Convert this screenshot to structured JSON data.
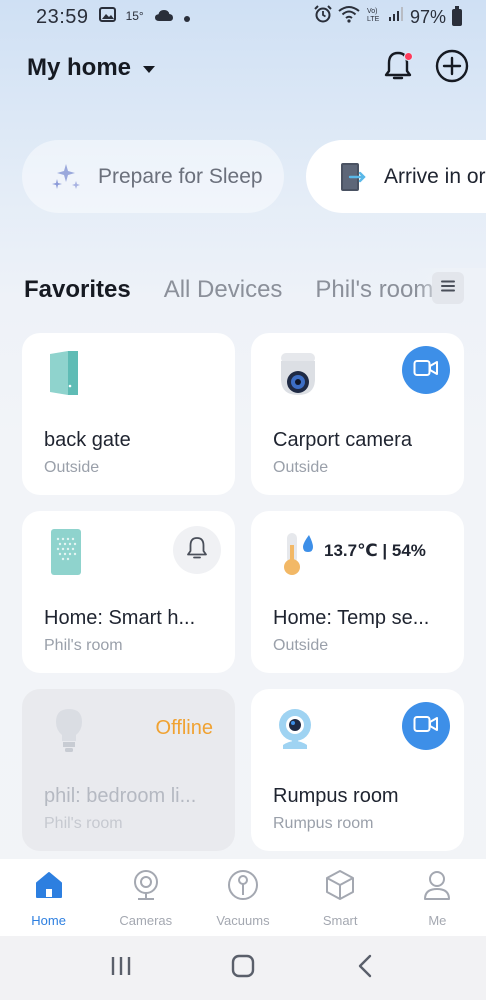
{
  "status": {
    "time": "23:59",
    "temperature": "15°",
    "battery": "97%"
  },
  "header": {
    "title": "My home"
  },
  "scenes": [
    {
      "label": "Prepare for Sleep"
    },
    {
      "label": "Arrive in or"
    }
  ],
  "tabs": [
    {
      "label": "Favorites"
    },
    {
      "label": "All Devices"
    },
    {
      "label": "Phil's room"
    }
  ],
  "devices": [
    {
      "name": "back gate",
      "room": "Outside"
    },
    {
      "name": "Carport camera",
      "room": "Outside"
    },
    {
      "name": "Home: Smart h...",
      "room": "Phil's room"
    },
    {
      "name": "Home: Temp se...",
      "room": "Outside",
      "reading": "13.7℃ | 54%"
    },
    {
      "name": "phil: bedroom li...",
      "room": "Phil's room",
      "status": "Offline"
    },
    {
      "name": "Rumpus room",
      "room": "Rumpus room"
    }
  ],
  "nav": [
    {
      "label": "Home"
    },
    {
      "label": "Cameras"
    },
    {
      "label": "Vacuums"
    },
    {
      "label": "Smart"
    },
    {
      "label": "Me"
    }
  ],
  "colors": {
    "accent": "#2d7fe0",
    "camera_button": "#3d8fe8",
    "offline": "#f0a232",
    "notification_dot": "#ff3b5c"
  }
}
